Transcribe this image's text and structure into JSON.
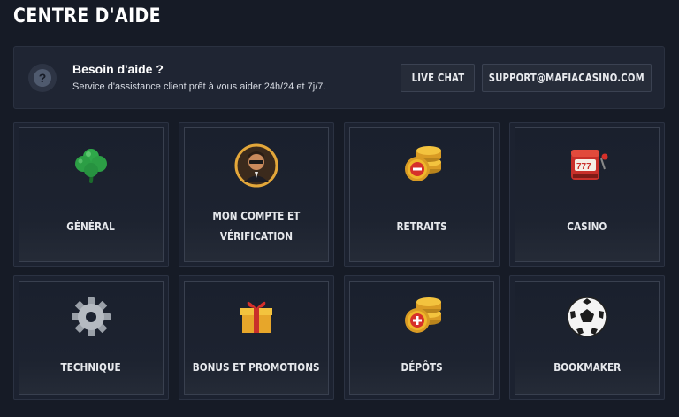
{
  "page": {
    "title": "CENTRE D'AIDE"
  },
  "banner": {
    "icon": "question-circle-icon",
    "title": "Besoin d'aide ?",
    "description": "Service d'assistance client prêt à vous aider 24h/24 et 7j/7.",
    "live_chat_label": "LIVE CHAT",
    "email_label": "SUPPORT@MAFIACASINO.COM"
  },
  "categories": [
    {
      "label": "GÉNÉRAL",
      "icon": "clover-icon"
    },
    {
      "label_line1": "MON COMPTE ET",
      "label_line2": "VÉRIFICATION",
      "icon": "avatar-icon"
    },
    {
      "label": "RETRAITS",
      "icon": "coins-minus-icon"
    },
    {
      "label": "CASINO",
      "icon": "slot-machine-icon"
    },
    {
      "label": "TECHNIQUE",
      "icon": "gear-icon"
    },
    {
      "label": "BONUS ET PROMOTIONS",
      "icon": "gift-icon"
    },
    {
      "label": "DÉPÔTS",
      "icon": "coins-plus-icon"
    },
    {
      "label": "BOOKMAKER",
      "icon": "soccer-ball-icon"
    }
  ],
  "colors": {
    "background": "#161b26",
    "card": "#1c2230",
    "gold": "#f0b72c",
    "red": "#d6302a",
    "green": "#2fa84a"
  }
}
